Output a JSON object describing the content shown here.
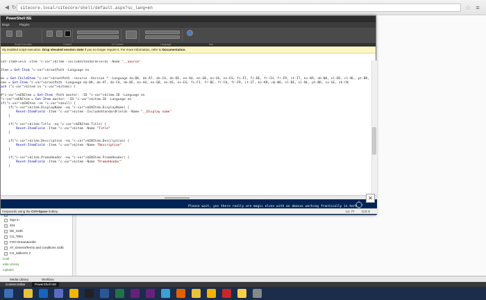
{
  "browser": {
    "url": "sitecore.local/sitecore/shell/default.aspx?sc_lang=en"
  },
  "dialog": {
    "title": "PowerShell ISE",
    "tabs": [
      "ttings",
      "Plugins"
    ],
    "ribbon_groups": [
      "Script Execution",
      "Context",
      "UI Context",
      "Language",
      "Info"
    ],
    "notice_prefix": "nly enabled script execution. ",
    "notice_bold": "Drop elevated session state",
    "notice_suffix": " if you no longer require it. For more information, refer to ",
    "notice_link": "Documentation."
  },
  "code_lines": [
    "set-ItemField -Item $item -IncludeStandardFields -Name \"__Source\"",
    "",
    "Item = Get-Item $rootPath -Language en",
    "",
    "ms = Get-ChildItem $rootPath -recurse -Version * -Language da-DK, de-AT, de-CH, de-DE, en-AU, en-GB, en-US, es-ES, fi-FI, fr-BE, fr-CH, fr-FR, it-IT, ks-KR, nb-NO, nl-BE, nl-NL, pt-BR,",
    "ems = Get-Item $rootPath -Language da-DK, de-AT, de-CH, de-DE, en-AU, en-GB, en-US, es-ES, fi-FI, fr-BE, fr-CH, fr-FR, it-IT, ks-KR, nb-NO, nl-BE, nl-NL, pt-BR, sv-SE, zh-CN",
    "ach ($item in $items) {",
    "",
    "#$ENItem = Get-Item -Path master: -ID $item.ID -Language en",
    "$ENItem = Get-Item master: -ID $item.ID -Language en",
    "if($ENItem -ne $null) {",
    "    if($item.DisplayName -eq $ENItem.DisplayName) {",
    "        Reset-ItemField -Item $item -IncludeStandardFields -Name \"__Display name\"",
    "    }",
    "",
    "    if($item.Title -eq $ENItem.Title) {",
    "        Reset-ItemField -Item $item -Name \"Title\"",
    "    }",
    "",
    "    if($item.Description -eq $ENItem.Description) {",
    "        Reset-ItemField -Item $item -Name \"Description\"",
    "    }",
    "",
    "    if($item.PromoHeader -eq $ENItem.PromoHeader) {",
    "        Reset-ItemField -Item $item -Name \"PromoHeader\"",
    "    }"
  ],
  "console": {
    "message": "Please wait, yes there really are magic elves with an abacus working frantically in here."
  },
  "status": {
    "hint_prefix": "l keywords using the ",
    "hint_bold": "Ctrl+Space",
    "hint_suffix": " hotkey.",
    "position": "Ln: 77",
    "column": "Col: 0"
  },
  "tree": {
    "items": [
      {
        "label": "ublished_For users",
        "checked": true
      },
      {
        "label": "Sign in",
        "checked": true
      },
      {
        "label": "404",
        "checked": true
      },
      {
        "label": "DE_410b",
        "checked": true
      },
      {
        "label": "CS_TitEs",
        "checked": true
      },
      {
        "label": "FOO Dream&order",
        "checked": true
      },
      {
        "label": "AT_GeneralTerms and conditions 410b",
        "checked": true
      },
      {
        "label": "CS_SellerXX 2",
        "checked": true
      }
    ],
    "bottom_items": [
      "ocial",
      "edia Library",
      "mplates"
    ]
  },
  "sitecore_bar": {
    "media": "Media Library",
    "workbox": "Workbox"
  },
  "sitecore_tabs": [
    "Content Editor",
    "PowerShell ISE"
  ],
  "taskbar_icons": [
    "chrome-icon",
    "outlook-icon",
    "teams-icon",
    "explorer-icon",
    "cmd-icon",
    "word-icon",
    "excel-icon",
    "vs-icon",
    "vs-icon",
    "notepad-icon",
    "firefox-icon",
    "chrome-icon",
    "explorer-icon",
    "acrobat-icon",
    "sticky-icon",
    "misc-icon"
  ]
}
